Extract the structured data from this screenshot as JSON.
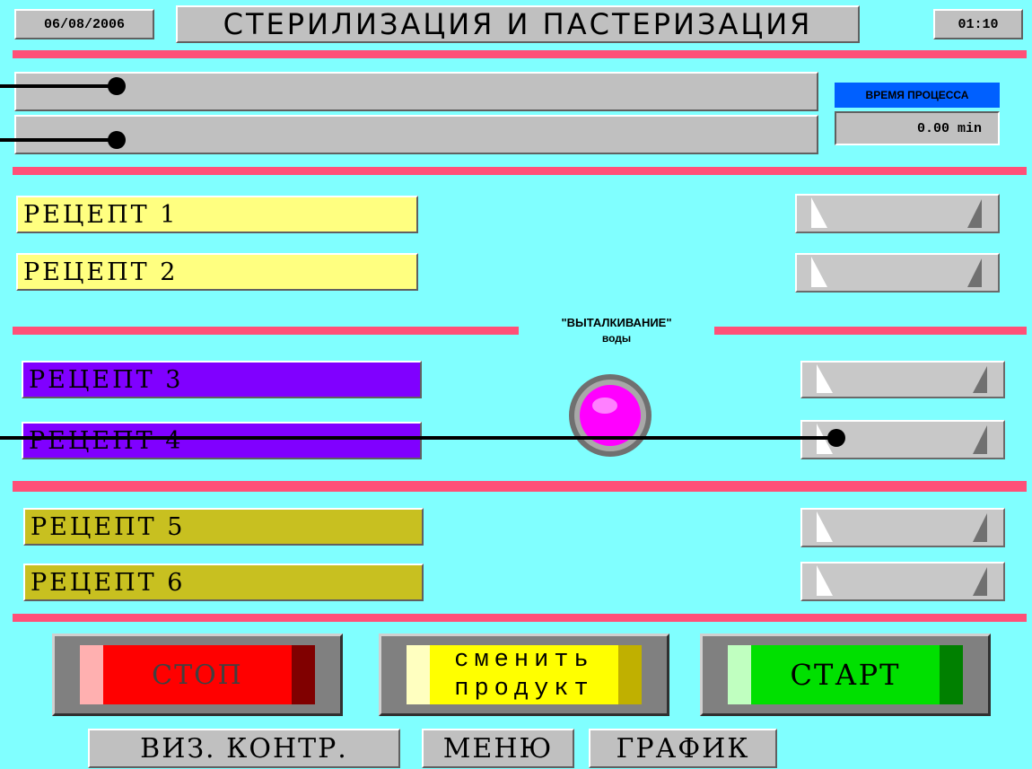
{
  "header": {
    "date": "06/08/2006",
    "title": "СТЕРИЛИЗАЦИЯ И ПАСТЕРИЗАЦИЯ",
    "time": "01:10"
  },
  "process_time": {
    "label": "ВРЕМЯ ПРОЦЕССА",
    "value": "0.00 min"
  },
  "recipes": [
    {
      "label": "РЕЦЕПТ 1"
    },
    {
      "label": "РЕЦЕПТ 2"
    },
    {
      "label": "РЕЦЕПТ 3"
    },
    {
      "label": "РЕЦЕПТ 4"
    },
    {
      "label": "РЕЦЕПТ 5"
    },
    {
      "label": "РЕЦЕПТ 6"
    }
  ],
  "water_push": {
    "line1": "\"ВЫТАЛКИВАНИЕ\"",
    "line2": "воды"
  },
  "buttons": {
    "stop": "СТОП",
    "change_line1": "сменить",
    "change_line2": "продукт",
    "start": "СТАРТ"
  },
  "nav": {
    "viz": "ВИЗ. КОНТР.",
    "menu": "МЕНЮ",
    "graph": "ГРАФИК"
  },
  "colors": {
    "background": "#80ffff",
    "divider": "#ff5078",
    "recipe_yellow": "#ffff80",
    "recipe_purple": "#8000ff",
    "recipe_olive": "#c8c020",
    "stop_red": "#ff0000",
    "start_green": "#00e000",
    "indicator": "#ff00ff",
    "process_label_bg": "#0060ff"
  }
}
